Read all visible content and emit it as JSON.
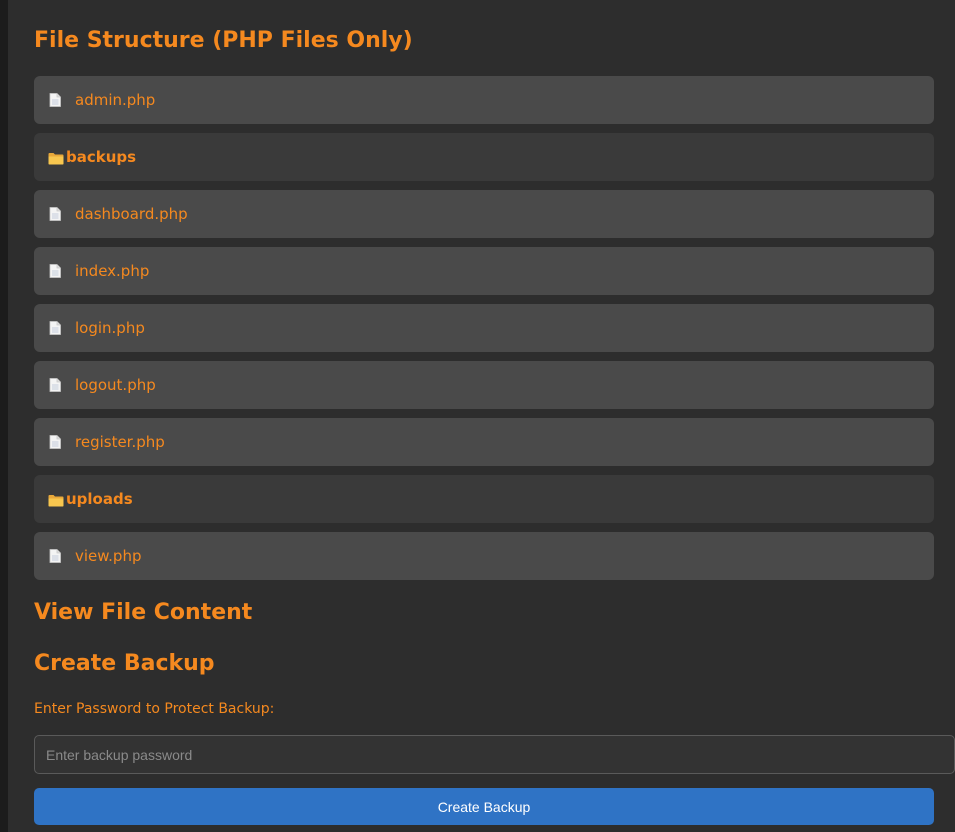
{
  "sections": {
    "structure_title": "File Structure (PHP Files Only)",
    "view_title": "View File Content",
    "backup_title": "Create Backup"
  },
  "files": [
    {
      "type": "file",
      "name": "admin.php",
      "icon": "file-icon"
    },
    {
      "type": "folder",
      "name": "backups",
      "icon": "folder-icon"
    },
    {
      "type": "file",
      "name": "dashboard.php",
      "icon": "file-icon"
    },
    {
      "type": "file",
      "name": "index.php",
      "icon": "file-icon"
    },
    {
      "type": "file",
      "name": "login.php",
      "icon": "file-icon"
    },
    {
      "type": "file",
      "name": "logout.php",
      "icon": "file-icon"
    },
    {
      "type": "file",
      "name": "register.php",
      "icon": "file-icon"
    },
    {
      "type": "folder",
      "name": "uploads",
      "icon": "folder-icon"
    },
    {
      "type": "file",
      "name": "view.php",
      "icon": "file-icon"
    }
  ],
  "backup": {
    "password_label": "Enter Password to Protect Backup:",
    "password_placeholder": "Enter backup password",
    "password_value": "",
    "button_label": "Create Backup"
  },
  "colors": {
    "accent": "#f5891f",
    "button": "#2f73c5",
    "panel": "#2d2d2d",
    "file_row": "#4a4a4a",
    "folder_row": "#3a3a3a"
  }
}
